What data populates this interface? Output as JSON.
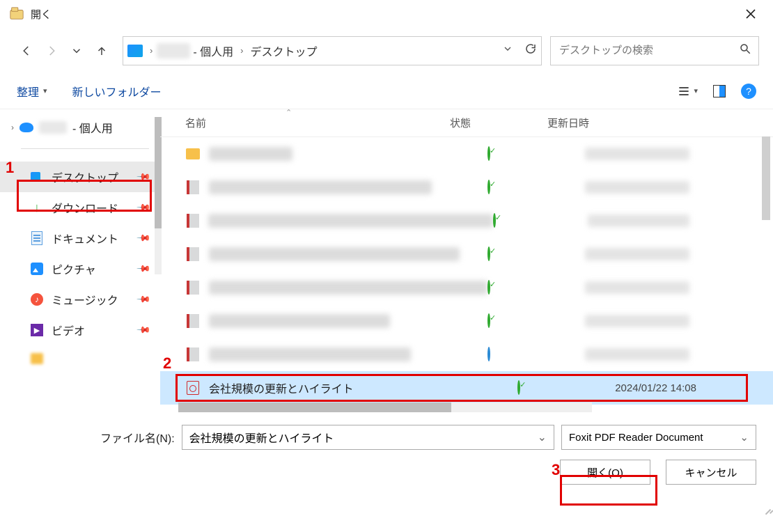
{
  "title": "開く",
  "path": {
    "user": "- 個人用",
    "loc": "デスクトップ"
  },
  "search": {
    "placeholder": "デスクトップの検索"
  },
  "toolbar": {
    "organize": "整理",
    "newFolder": "新しいフォルダー"
  },
  "crumb": {
    "user": "- 個人用"
  },
  "sidebar": {
    "items": [
      {
        "label": "デスクトップ"
      },
      {
        "label": "ダウンロード"
      },
      {
        "label": "ドキュメント"
      },
      {
        "label": "ピクチャ"
      },
      {
        "label": "ミュージック"
      },
      {
        "label": "ビデオ"
      }
    ]
  },
  "columns": {
    "name": "名前",
    "status": "状態",
    "date": "更新日時"
  },
  "selectedFile": {
    "name": "会社規模の更新とハイライト",
    "date": "2024/01/22 14:08"
  },
  "footer": {
    "fnLabel": "ファイル名(N):",
    "fnValue": "会社規模の更新とハイライト",
    "typeValue": "Foxit PDF Reader Document",
    "open": "開く(O)",
    "cancel": "キャンセル"
  },
  "annotations": {
    "n1": "1",
    "n2": "2",
    "n3": "3"
  }
}
